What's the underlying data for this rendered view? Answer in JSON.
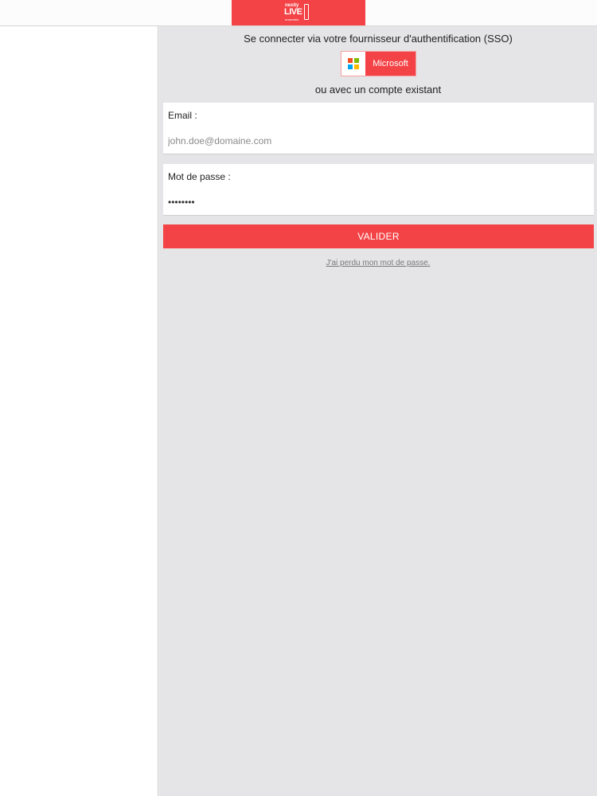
{
  "header": {
    "logo": {
      "line1": "nexity",
      "line2": "LIVE",
      "line3": "ensemble"
    }
  },
  "sso": {
    "title": "Se connecter via votre fournisseur d'authentification (SSO)",
    "microsoft_label": "Microsoft",
    "microsoft_logo_colors": [
      "#f25022",
      "#7fba00",
      "#00a4ef",
      "#ffb900"
    ]
  },
  "login": {
    "alt_text": "ou avec un compte existant",
    "email_label": "Email :",
    "email_placeholder": "john.doe@domaine.com",
    "password_label": "Mot de passe :",
    "password_value": "••••••••",
    "submit_label": "VALIDER",
    "forgot_label": "J'ai perdu mon mot de passe."
  },
  "colors": {
    "accent": "#f44346",
    "background": "#e5e4e6"
  }
}
